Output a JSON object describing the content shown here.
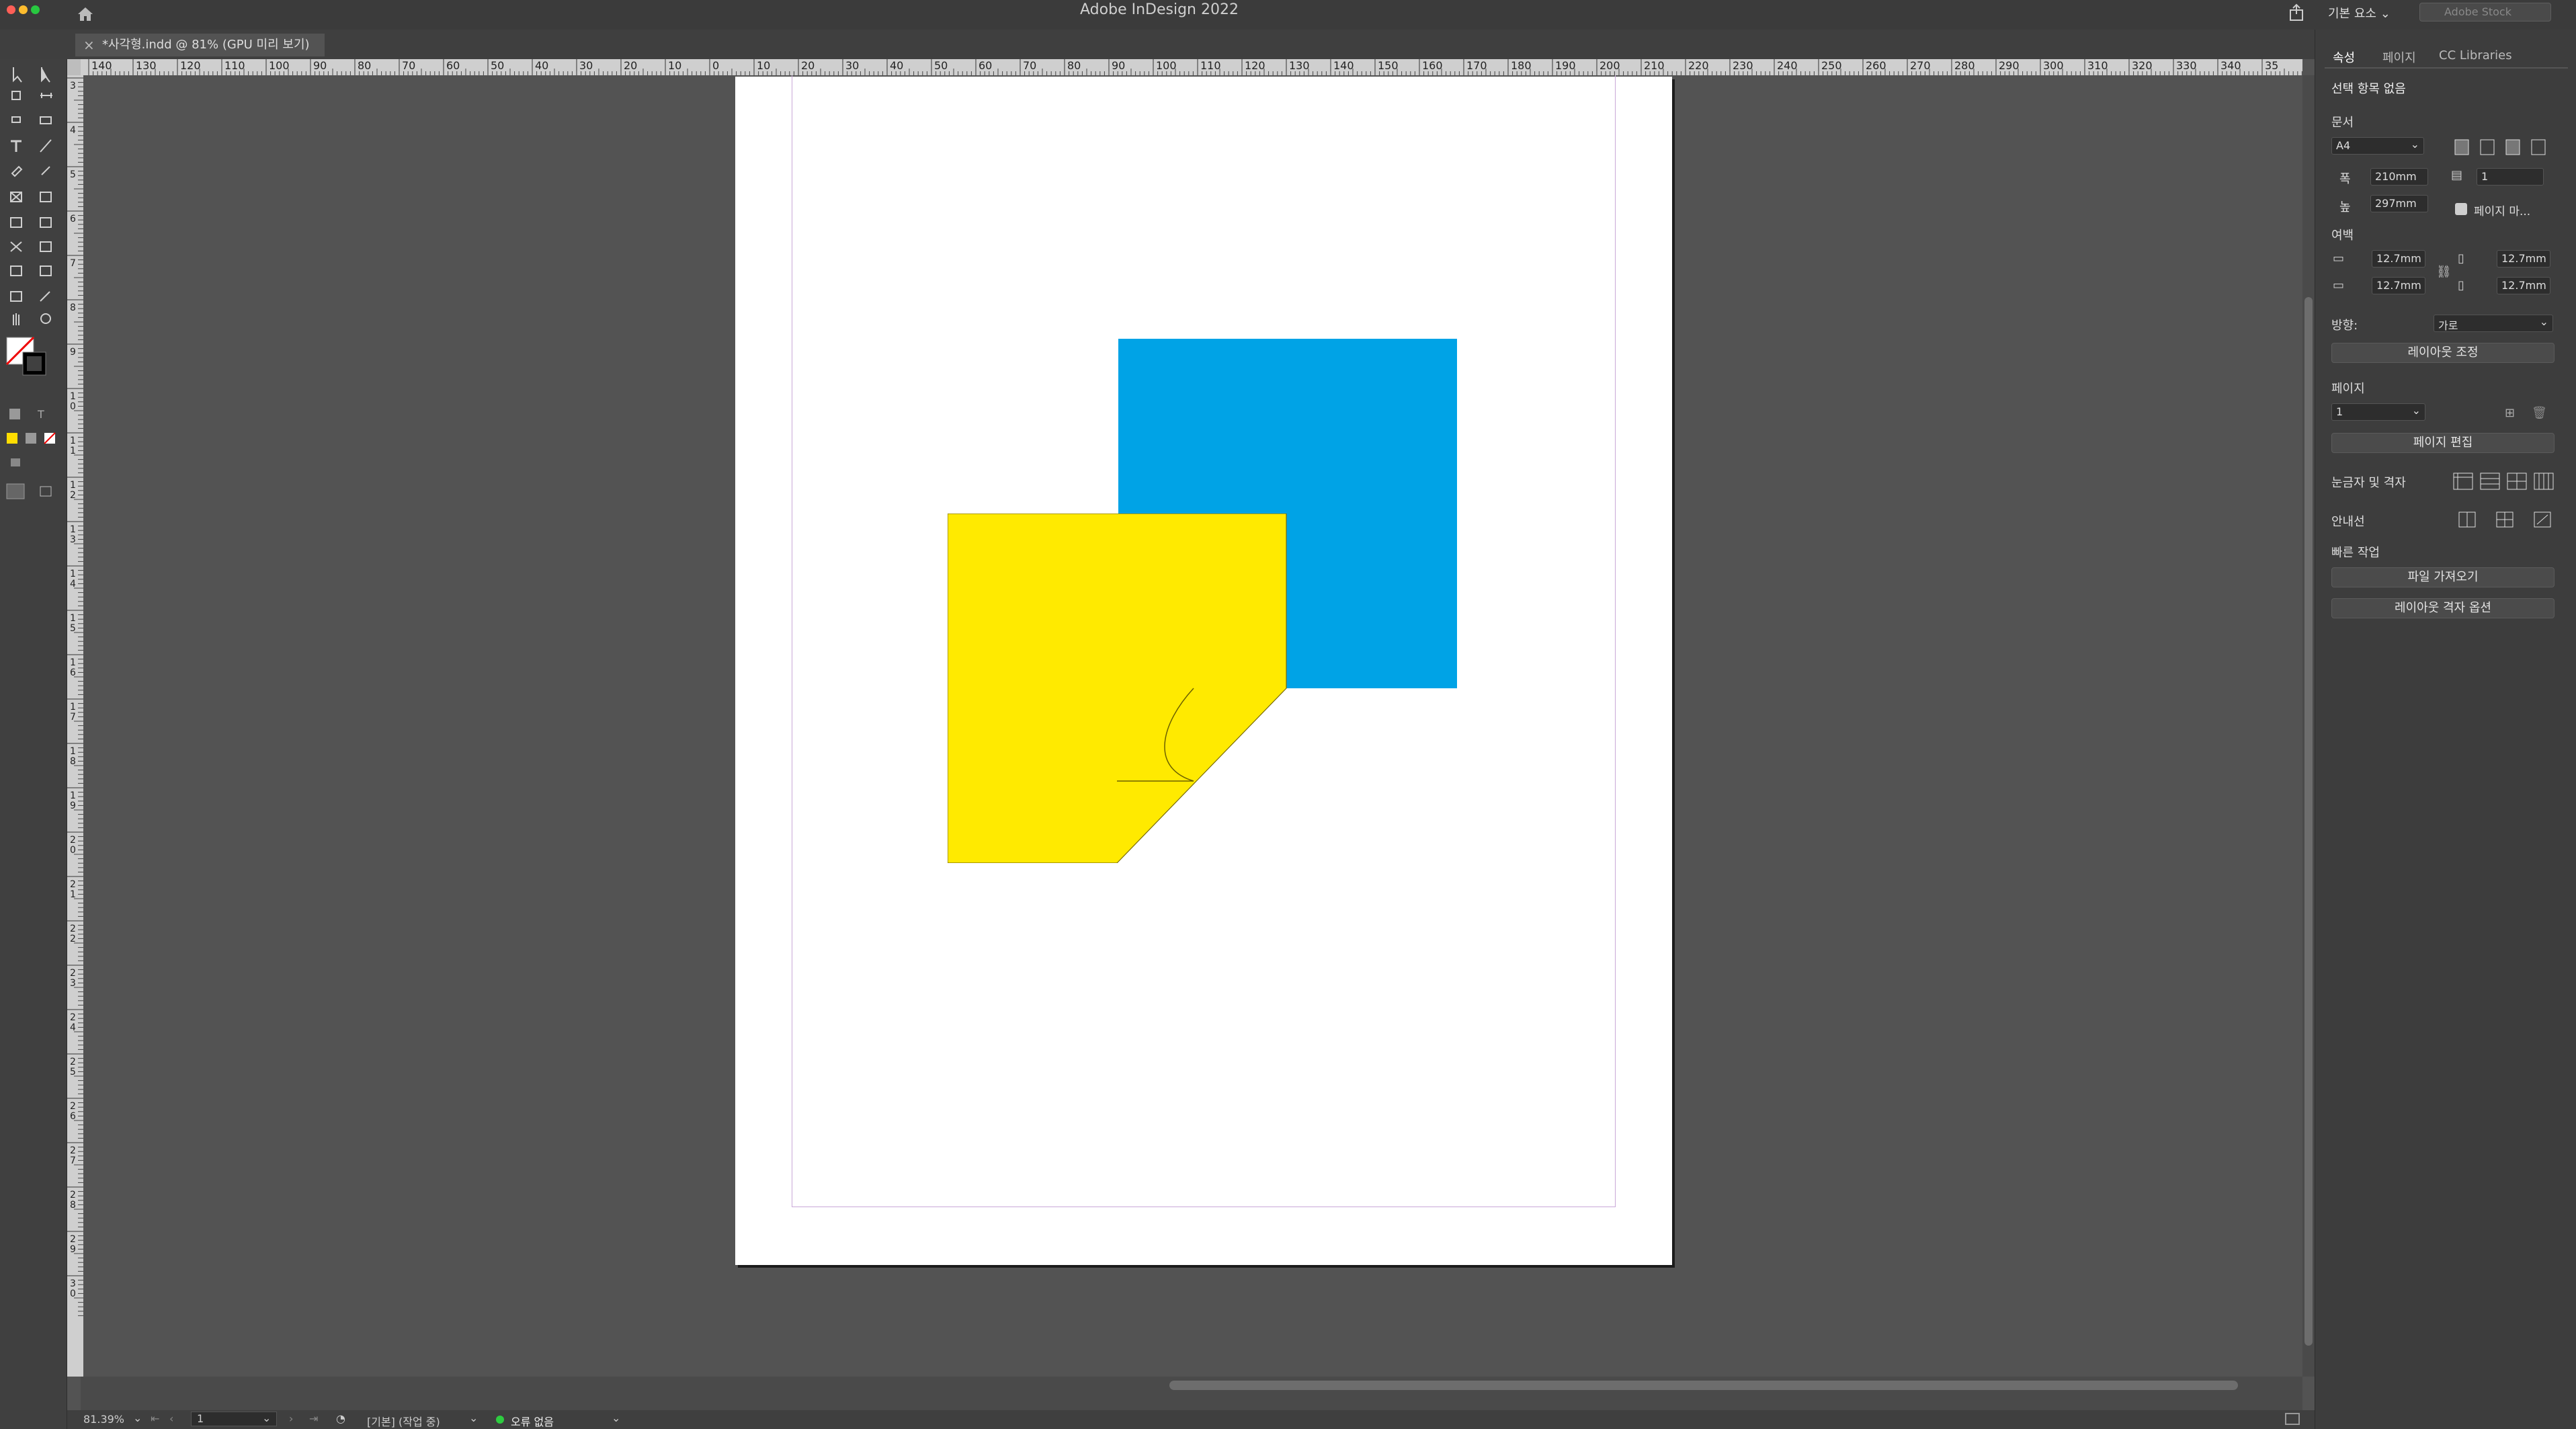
{
  "window": {
    "title": "Adobe InDesign 2022"
  },
  "header": {
    "workspace": "기본 요소",
    "stock_search_placeholder": "Adobe Stock"
  },
  "document_tab": {
    "title": "*사각형.indd @ 81% (GPU 미리 보기)"
  },
  "ruler_top_labels": [
    "140",
    "130",
    "120",
    "110",
    "100",
    "90",
    "80",
    "70",
    "60",
    "50",
    "40",
    "30",
    "20",
    "10",
    "0",
    "10",
    "20",
    "30",
    "40",
    "50",
    "60",
    "70",
    "80",
    "90",
    "100",
    "110",
    "120",
    "130",
    "140",
    "150",
    "160",
    "170",
    "180",
    "190",
    "200",
    "210",
    "220",
    "230",
    "240",
    "250",
    "260",
    "270",
    "280",
    "290",
    "300",
    "310",
    "320",
    "330",
    "340",
    "35"
  ],
  "ruler_left_labels": [
    "3",
    "4",
    "5",
    "6",
    "7",
    "8",
    "9",
    "10",
    "11",
    "12",
    "13",
    "14",
    "15",
    "16",
    "17",
    "18",
    "19",
    "20",
    "21",
    "22",
    "23",
    "24",
    "25",
    "26",
    "27",
    "28",
    "29",
    "30"
  ],
  "panel": {
    "tabs": [
      "속성",
      "페이지",
      "CC Libraries"
    ],
    "selection": "선택 항목 없음",
    "document_label": "문서",
    "page_size": "A4",
    "width_label": "폭",
    "width_value": "210mm",
    "height_label": "높",
    "height_value": "297mm",
    "pages_value": "1",
    "facing_pages_label": "페이지 마...",
    "margins_label": "여백",
    "margin_top": "12.7mm",
    "margin_bottom": "12.7mm",
    "margin_left": "12.7mm",
    "margin_right": "12.7mm",
    "orientation_label": "방향:",
    "orientation_value": "가로",
    "adjust_layout_button": "레이아웃 조정",
    "page_section_label": "페이지",
    "page_value": "1",
    "edit_page_button": "페이지 편집",
    "rulers_grids_label": "눈금자 및 격자",
    "guides_label": "안내선",
    "quick_actions_label": "빠른 작업",
    "import_file_button": "파일 가져오기",
    "layout_grid_options_button": "레이아웃 격자 옵션"
  },
  "status": {
    "zoom": "81.39%",
    "page": "1",
    "preflight_profile": "[기본] (작업 중)",
    "errors": "오류 없음"
  },
  "colors": {
    "blue": "#00a3e6",
    "yellow": "#ffea00",
    "page": "#ffffff",
    "pasteboard": "#535353",
    "panel": "#3d3d3d",
    "no_errors_dot": "#2ecc40"
  }
}
